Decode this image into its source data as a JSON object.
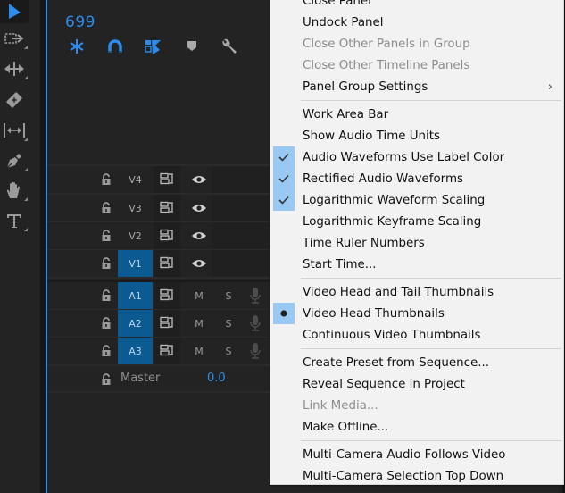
{
  "tools_panel": {
    "tools": [
      {
        "name": "selection-tool",
        "icon": "arrow-icon",
        "active": true
      },
      {
        "name": "track-select-forward-tool",
        "icon": "track-select-icon"
      },
      {
        "name": "ripple-edit-tool",
        "icon": "ripple-edit-icon"
      },
      {
        "name": "razor-tool",
        "icon": "razor-icon"
      },
      {
        "name": "slip-tool",
        "icon": "slip-icon"
      },
      {
        "name": "pen-tool",
        "icon": "pen-icon"
      },
      {
        "name": "hand-tool",
        "icon": "hand-icon"
      },
      {
        "name": "type-tool",
        "icon": "type-icon"
      }
    ]
  },
  "timeline": {
    "timecode": "699",
    "toolbar": [
      {
        "name": "nest-toggle",
        "icon": "insert-overwrite-icon"
      },
      {
        "name": "snap-toggle",
        "icon": "magnet-icon"
      },
      {
        "name": "linked-selection-toggle",
        "icon": "linked-selection-icon"
      },
      {
        "name": "add-marker",
        "icon": "marker-icon"
      },
      {
        "name": "timeline-settings",
        "icon": "wrench-icon"
      }
    ],
    "video_tracks": [
      {
        "label": "V4",
        "active": false
      },
      {
        "label": "V3",
        "active": false
      },
      {
        "label": "V2",
        "active": false
      },
      {
        "label": "V1",
        "active": true
      }
    ],
    "audio_tracks": [
      {
        "label": "A1",
        "active": true,
        "mute": "M",
        "solo": "S"
      },
      {
        "label": "A2",
        "active": true,
        "mute": "M",
        "solo": "S"
      },
      {
        "label": "A3",
        "active": true,
        "mute": "M",
        "solo": "S"
      }
    ],
    "master": {
      "label": "Master",
      "value": "0.0"
    }
  },
  "context_menu": {
    "items": [
      {
        "label": "Close Panel",
        "disabled": false
      },
      {
        "label": "Undock Panel",
        "disabled": false
      },
      {
        "label": "Close Other Panels in Group",
        "disabled": true
      },
      {
        "label": "Close Other Timeline Panels",
        "disabled": true
      },
      {
        "label": "Panel Group Settings",
        "disabled": false,
        "submenu": true,
        "submenu_glyph": "›"
      },
      {
        "separator": true
      },
      {
        "label": "Work Area Bar",
        "disabled": false
      },
      {
        "label": "Show Audio Time Units",
        "disabled": false
      },
      {
        "label": "Audio Waveforms Use Label Color",
        "disabled": false,
        "checked": true,
        "check_glyph": "✓"
      },
      {
        "label": "Rectified Audio Waveforms",
        "disabled": false,
        "checked": true,
        "check_glyph": "✓"
      },
      {
        "label": "Logarithmic Waveform Scaling",
        "disabled": false,
        "checked": true,
        "check_glyph": "✓"
      },
      {
        "label": "Logarithmic Keyframe Scaling",
        "disabled": false
      },
      {
        "label": "Time Ruler Numbers",
        "disabled": false
      },
      {
        "label": "Start Time...",
        "disabled": false
      },
      {
        "separator": true
      },
      {
        "label": "Video Head and Tail Thumbnails",
        "disabled": false
      },
      {
        "label": "Video Head Thumbnails",
        "disabled": false,
        "radio": true,
        "radio_glyph": "●"
      },
      {
        "label": "Continuous Video Thumbnails",
        "disabled": false
      },
      {
        "separator": true
      },
      {
        "label": "Create Preset from Sequence...",
        "disabled": false
      },
      {
        "label": "Reveal Sequence in Project",
        "disabled": false
      },
      {
        "label": "Link Media...",
        "disabled": true
      },
      {
        "label": "Make Offline...",
        "disabled": false
      },
      {
        "separator": true
      },
      {
        "label": "Multi-Camera Audio Follows Video",
        "disabled": false
      },
      {
        "label": "Multi-Camera Selection Top Down",
        "disabled": false
      }
    ]
  },
  "colors": {
    "accent": "#2d8ceb",
    "track_active": "#0c5a92",
    "menu_bg": "#f2f2f2",
    "menu_check_bg": "#99c9f3"
  }
}
